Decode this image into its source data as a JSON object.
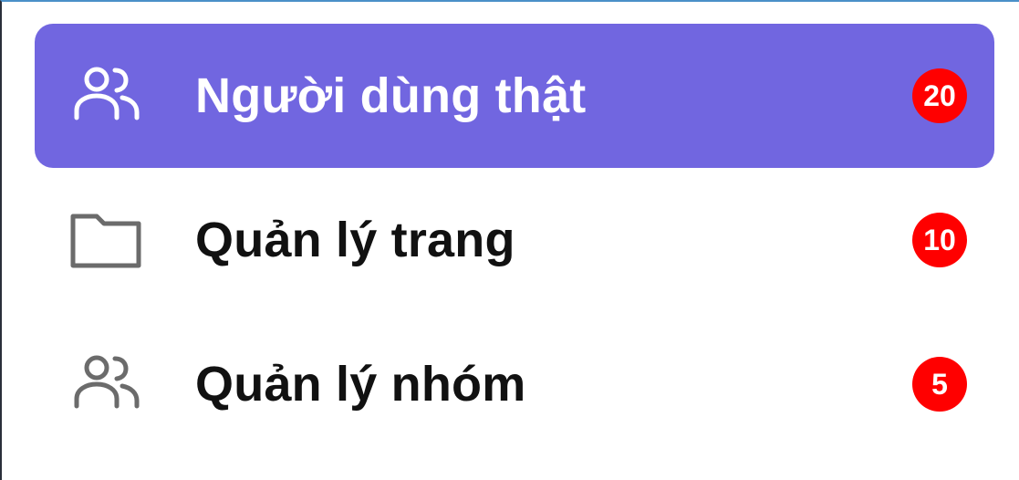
{
  "menu": {
    "items": [
      {
        "label": "Người dùng thật",
        "count": "20",
        "icon": "users-icon",
        "active": true
      },
      {
        "label": "Quản lý trang",
        "count": "10",
        "icon": "folder-icon",
        "active": false
      },
      {
        "label": "Quản lý nhóm",
        "count": "5",
        "icon": "users-icon",
        "active": false
      }
    ]
  },
  "colors": {
    "active_bg": "#7166e0",
    "badge_bg": "#ff0000",
    "icon_inactive": "#6b6b6b",
    "icon_active": "#ffffff",
    "text_inactive": "#111111",
    "text_active": "#ffffff"
  }
}
